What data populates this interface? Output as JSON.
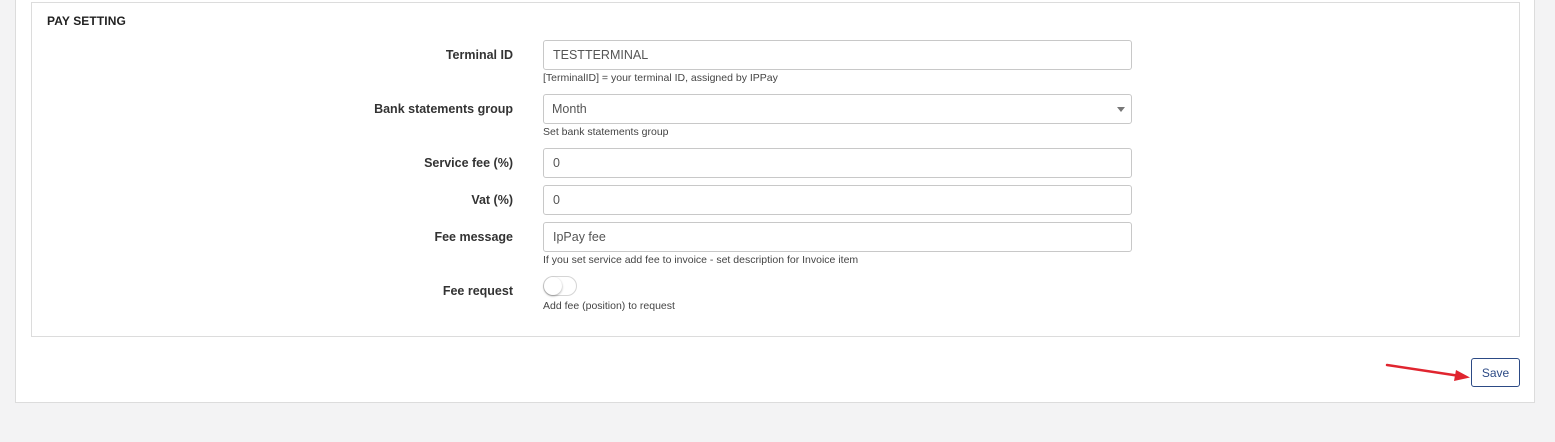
{
  "section": {
    "title": "PAY SETTING"
  },
  "fields": {
    "terminal_id": {
      "label": "Terminal ID",
      "value": "TESTTERMINAL",
      "help": "[TerminalID] = your terminal ID, assigned by IPPay"
    },
    "bank_statements_group": {
      "label": "Bank statements group",
      "value": "Month",
      "help": "Set bank statements group"
    },
    "service_fee": {
      "label": "Service fee (%)",
      "value": "0"
    },
    "vat": {
      "label": "Vat (%)",
      "value": "0"
    },
    "fee_message": {
      "label": "Fee message",
      "value": "IpPay fee",
      "help": "If you set service add fee to invoice - set description for Invoice item"
    },
    "fee_request": {
      "label": "Fee request",
      "enabled": false,
      "help": "Add fee (position) to request"
    }
  },
  "actions": {
    "save_label": "Save"
  },
  "colors": {
    "accent": "#2c4a85",
    "annotation_arrow": "#e0252f"
  }
}
